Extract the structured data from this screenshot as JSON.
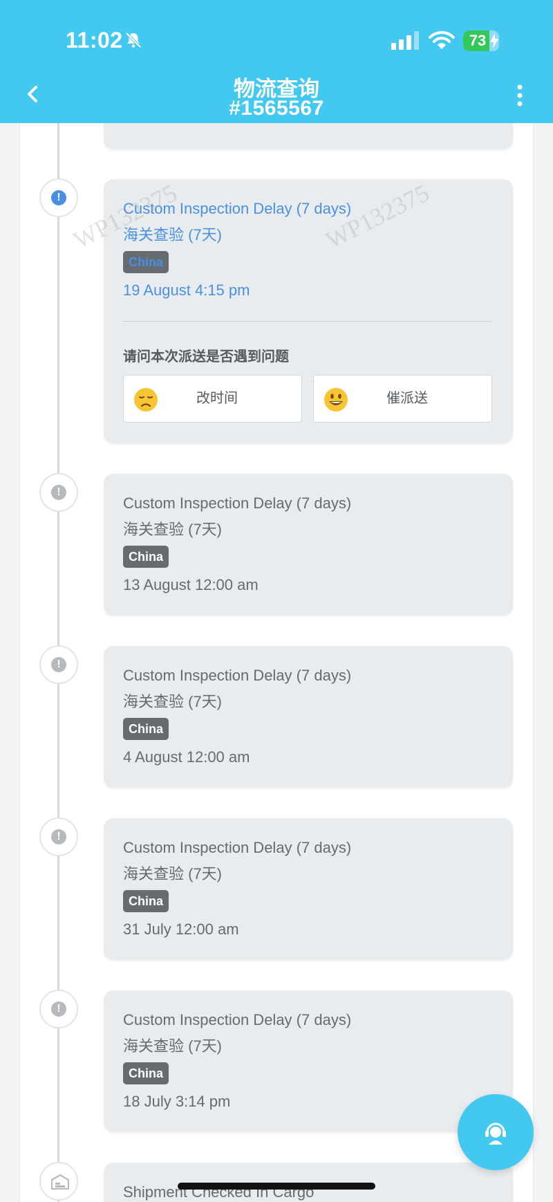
{
  "status_bar": {
    "time": "11:02",
    "battery_percent": "73",
    "battery_level": 0.73
  },
  "header": {
    "title": "物流查询",
    "order_number": "#1565567"
  },
  "question": {
    "prompt": "请问本次派送是否遇到问题",
    "options": [
      {
        "label": "改时间",
        "emoji": "frowning-face"
      },
      {
        "label": "催派送",
        "emoji": "smiling-face"
      }
    ]
  },
  "watermark": "WP132375",
  "events": [
    {
      "title_en": "Custom Inspection Delay (7 days)",
      "title_cn": "海关查验 (7天)",
      "badge": "China",
      "date": "19 August 4:15 pm",
      "active": true,
      "icon": "exclamation-icon"
    },
    {
      "title_en": "Custom Inspection Delay (7 days)",
      "title_cn": "海关查验 (7天)",
      "badge": "China",
      "date": "13 August 12:00 am",
      "active": false,
      "icon": "exclamation-icon"
    },
    {
      "title_en": "Custom Inspection Delay (7 days)",
      "title_cn": "海关查验 (7天)",
      "badge": "China",
      "date": "4 August 12:00 am",
      "active": false,
      "icon": "exclamation-icon"
    },
    {
      "title_en": "Custom Inspection Delay (7 days)",
      "title_cn": "海关查验 (7天)",
      "badge": "China",
      "date": "31 July 12:00 am",
      "active": false,
      "icon": "exclamation-icon"
    },
    {
      "title_en": "Custom Inspection Delay (7 days)",
      "title_cn": "海关查验 (7天)",
      "badge": "China",
      "date": "18 July 3:14 pm",
      "active": false,
      "icon": "exclamation-icon"
    },
    {
      "title_en": "Shipment Checked In Cargo",
      "active": false,
      "icon": "warehouse-icon"
    }
  ],
  "colors": {
    "header_bg": "#43c8ef",
    "active_blue": "#4a90e2",
    "card_bg": "#e9ecee",
    "badge_bg": "#666b70"
  }
}
